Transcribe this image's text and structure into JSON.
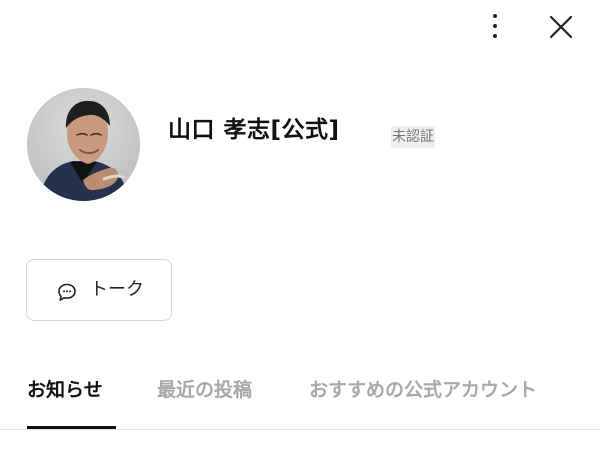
{
  "profile": {
    "name": "山口 孝志[公式]",
    "badge": "未認証"
  },
  "actions": {
    "talk_label": "トーク",
    "talk_icon": "chat-bubble-icon",
    "menu_icon": "more-vertical-icon",
    "close_icon": "close-icon"
  },
  "tabs": [
    {
      "label": "お知らせ",
      "active": true
    },
    {
      "label": "最近の投稿",
      "active": false
    },
    {
      "label": "おすすめの公式アカウント",
      "active": false
    }
  ],
  "colors": {
    "text": "#111111",
    "inactive_tab": "#a8a8a8",
    "border": "#d7d7d7",
    "badge_bg": "#eeeeee"
  }
}
